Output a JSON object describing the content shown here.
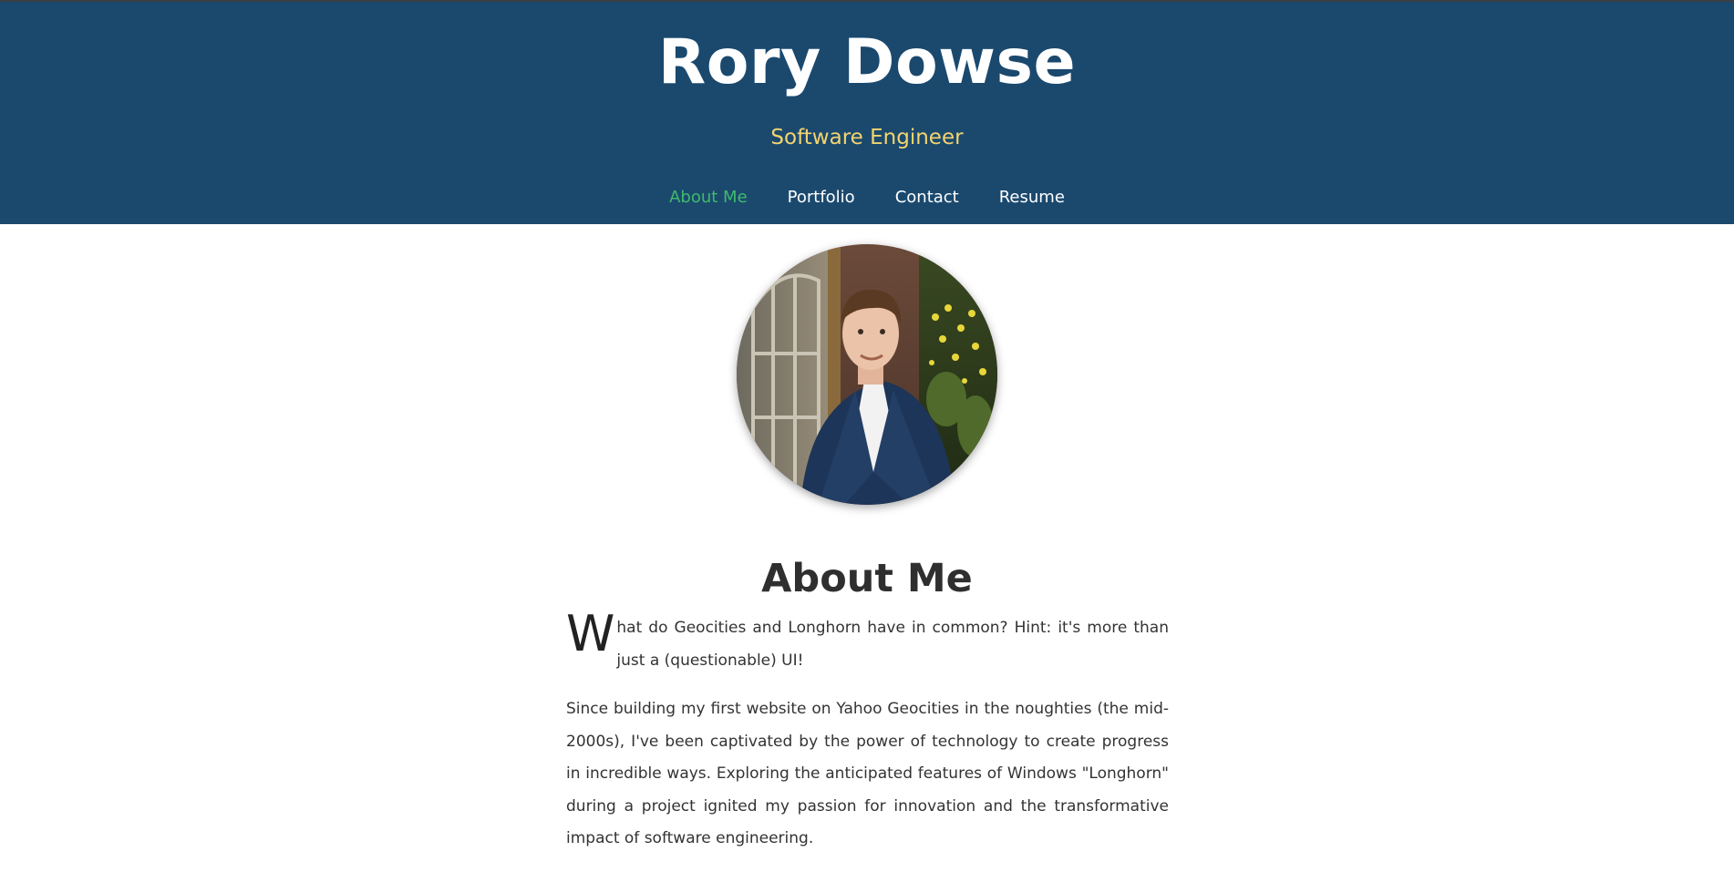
{
  "header": {
    "name": "Rory Dowse",
    "role": "Software Engineer"
  },
  "nav": {
    "items": [
      {
        "label": "About Me",
        "active": true
      },
      {
        "label": "Portfolio",
        "active": false
      },
      {
        "label": "Contact",
        "active": false
      },
      {
        "label": "Resume",
        "active": false
      }
    ]
  },
  "colors": {
    "header_bg": "#1b496e",
    "role_text": "#f3d46e",
    "nav_active": "#3fba6c",
    "nav_text": "#ffffff"
  },
  "profile": {
    "image_icon": "profile-photo"
  },
  "about": {
    "title": "About Me",
    "intro_dropcap": "W",
    "intro_rest": "hat do Geocities and Longhorn have in common? Hint: it's more than just a (questionable) UI!",
    "paragraph_2": "Since building my first website on Yahoo Geocities in the noughties (the mid-2000s), I've been captivated by the power of technology to create progress in incredible ways. Exploring the anticipated features of Windows \"Longhorn\" during a project ignited my passion for innovation and the transformative impact of software engineering."
  }
}
